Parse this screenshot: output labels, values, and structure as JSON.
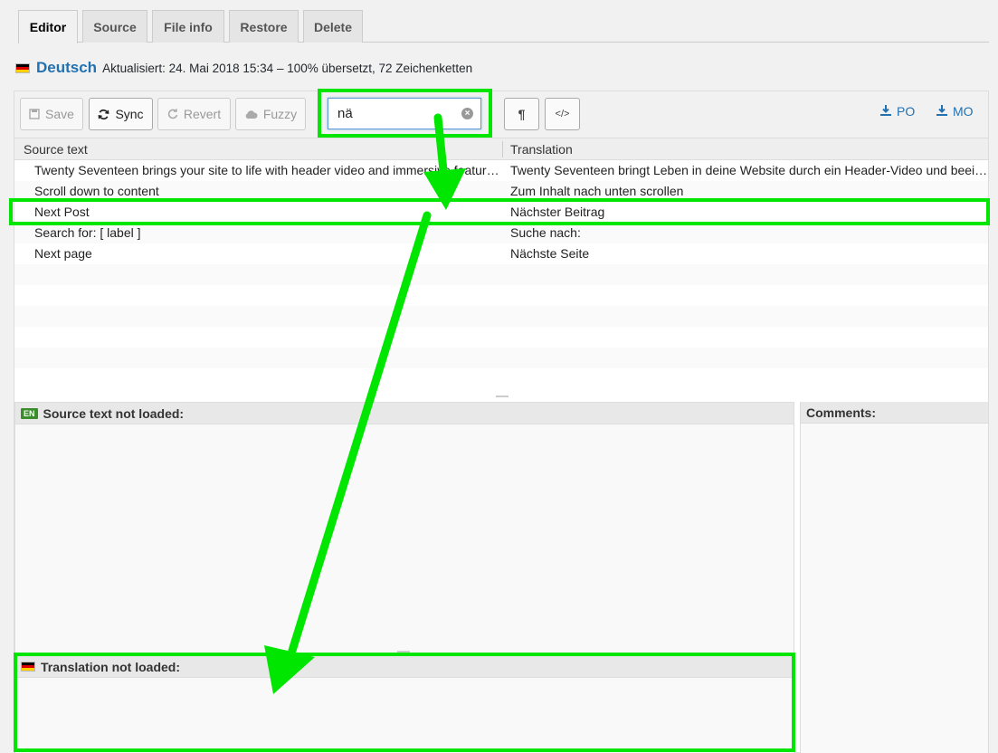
{
  "tabs": [
    {
      "label": "Editor",
      "active": true
    },
    {
      "label": "Source",
      "active": false
    },
    {
      "label": "File info",
      "active": false
    },
    {
      "label": "Restore",
      "active": false
    },
    {
      "label": "Delete",
      "active": false
    }
  ],
  "header": {
    "language": "Deutsch",
    "meta": "Aktualisiert: 24. Mai 2018 15:34 – 100% übersetzt, 72 Zeichenketten"
  },
  "toolbar": {
    "save_label": "Save",
    "sync_label": "Sync",
    "revert_label": "Revert",
    "fuzzy_label": "Fuzzy",
    "search_value": "nä",
    "pilcrow_label": "¶",
    "code_label": "</>",
    "po_label": "PO",
    "mo_label": "MO"
  },
  "grid": {
    "columns": [
      "Source text",
      "Translation"
    ],
    "rows": [
      {
        "source": "Twenty Seventeen brings your site to life with header video and immersive featured images.",
        "translation": "Twenty Seventeen bringt Leben in deine Website durch ein Header-Video und beeindruckende Beitragsbilder."
      },
      {
        "source": "Scroll down to content",
        "translation": "Zum Inhalt nach unten scrollen"
      },
      {
        "source": "Next Post",
        "translation": "Nächster Beitrag"
      },
      {
        "source": "Search for: [ label ]",
        "translation": "Suche nach:"
      },
      {
        "source": "Next page",
        "translation": "Nächste Seite"
      }
    ]
  },
  "panes": {
    "source_label": "Source text not loaded:",
    "source_badge": "EN",
    "comments_label": "Comments:",
    "translation_label": "Translation not loaded:"
  },
  "colors": {
    "accent": "#2271b1",
    "annotation": "#00e600"
  }
}
